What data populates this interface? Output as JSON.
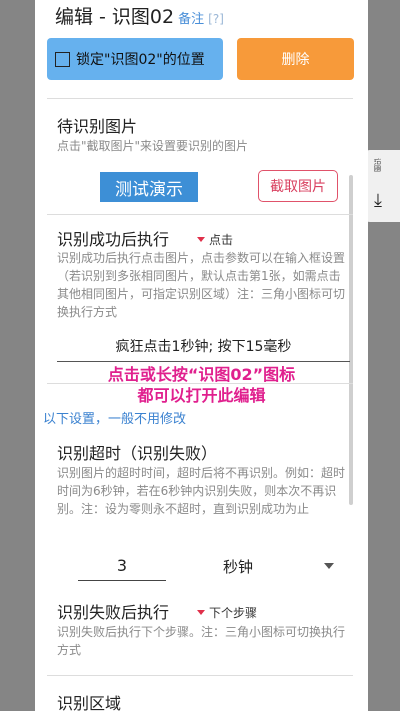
{
  "dialog": {
    "title": "编辑 - 识图02",
    "title_note": "备注",
    "title_help": "[?]"
  },
  "actions": {
    "lock_label": "锁定\"识图02\"的位置",
    "delete_label": "删除"
  },
  "image_section": {
    "title": "待识别图片",
    "desc": "点击\"截取图片\"来设置要识别的图片",
    "demo_label": "测试演示",
    "capture_label": "截取图片"
  },
  "success_section": {
    "title": "识别成功后执行",
    "mode": "点击",
    "desc": "识别成功后执行点击图片，点击参数可以在输入框设置（若识别到多张相同图片，默认点击第1张，如需点击其他相同图片，可指定识别区域）注：三角小图标可切换执行方式",
    "param_value": "疯狂点击1秒钟; 按下15毫秒"
  },
  "overlay": {
    "line1": "点击或长按“识图02”图标",
    "line2": "都可以打开此编辑"
  },
  "below_link": "以下设置，一般不用修改",
  "timeout_section": {
    "title": "识别超时（识别失败）",
    "desc": "识别图片的超时时间，超时后将不再识别。例如：超时时间为6秒钟，若在6秒钟内识别失败，则本次不再识别。注：设为零则永不超时，直到识别成功为止",
    "value": "3",
    "unit": "秒钟"
  },
  "fail_section": {
    "title": "识别失败后执行",
    "mode": "下个步骤",
    "desc": "识别失败后执行下个步骤。注：三角小图标可切换执行方式"
  },
  "region_section": {
    "title": "识别区域"
  },
  "side_widget": {
    "label": "识图"
  },
  "colors": {
    "accent_blue": "#66b1ee",
    "delete_orange": "#f79a3a",
    "hint_magenta": "#e0208e",
    "capture_red": "#d94060"
  }
}
